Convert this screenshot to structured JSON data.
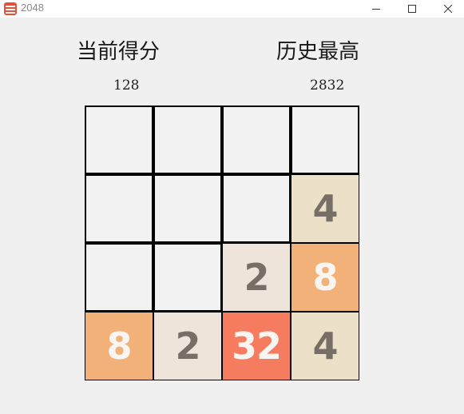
{
  "window": {
    "title": "2048",
    "icon": "app-2048-icon",
    "controls": [
      "minimize-icon",
      "maximize-icon",
      "close-icon"
    ]
  },
  "scoreboard": {
    "current_label": "当前得分",
    "current_value": "128",
    "best_label": "历史最高",
    "best_value": "2832"
  },
  "board": {
    "size": 4,
    "grid": [
      [
        0,
        0,
        0,
        0
      ],
      [
        0,
        0,
        0,
        4
      ],
      [
        0,
        0,
        2,
        8
      ],
      [
        8,
        2,
        32,
        4
      ]
    ],
    "tile_colors": {
      "2": {
        "bg": "#eee4da",
        "fg": "#776e65"
      },
      "4": {
        "bg": "#ede0c8",
        "fg": "#776e65"
      },
      "8": {
        "bg": "#f2b179",
        "fg": "#f9f6f2"
      },
      "32": {
        "bg": "#f67c5f",
        "fg": "#f9f6f2"
      }
    },
    "empty_color": "#f2f2f2",
    "line_color": "#000000"
  }
}
